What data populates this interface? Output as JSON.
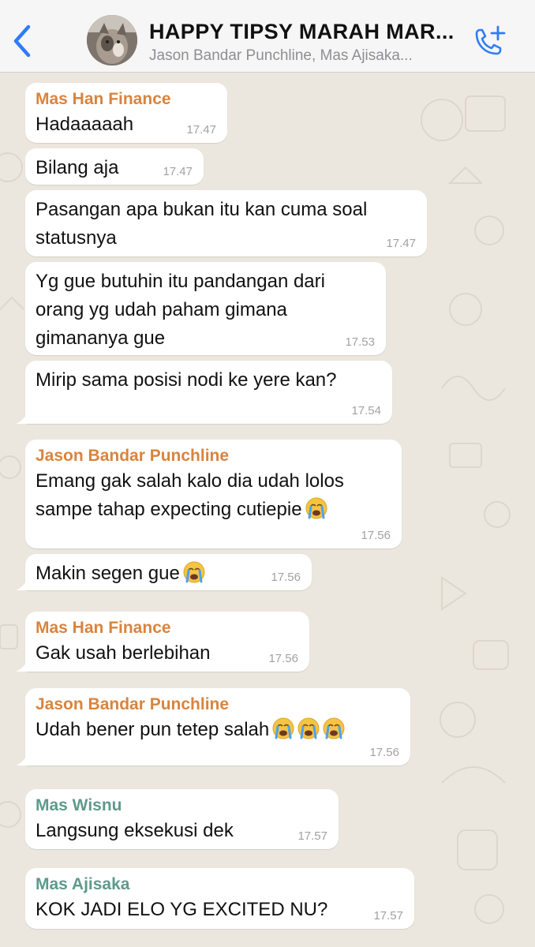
{
  "header": {
    "title": "HAPPY TIPSY MARAH MAR...",
    "subtitle": "Jason Bandar Punchline, Mas Ajisaka...",
    "back_icon": "chevron-left-icon",
    "call_icon": "add-call-icon",
    "accent": "#2f7cf6"
  },
  "colors": {
    "mas_han": "#d8843e",
    "jason": "#d8843e",
    "mas_wisnu": "#5e9a8c",
    "mas_ajisaka": "#5e9a8c"
  },
  "messages": [
    {
      "sender": "Mas Han Finance",
      "lines": [
        "Hadaaaaah"
      ],
      "time": "17.47"
    },
    {
      "sender": "",
      "lines": [
        "Bilang aja"
      ],
      "time": "17.47"
    },
    {
      "sender": "",
      "lines": [
        "Pasangan apa bukan itu kan cuma soal",
        "statusnya"
      ],
      "time": "17.47"
    },
    {
      "sender": "",
      "lines": [
        "Yg gue butuhin itu pandangan dari",
        "orang yg udah paham gimana",
        "gimananya gue"
      ],
      "time": "17.53"
    },
    {
      "sender": "",
      "lines": [
        "Mirip sama posisi nodi ke yere kan?"
      ],
      "time": "17.54"
    },
    {
      "sender": "Jason Bandar Punchline",
      "lines": [
        "Emang gak salah kalo dia udah lolos",
        "sampe tahap expecting cutiepie"
      ],
      "time": "17.56",
      "emoji": "crying-face-emoji"
    },
    {
      "sender": "",
      "lines": [
        "Makin segen gue"
      ],
      "time": "17.56",
      "emoji": "crying-face-emoji"
    },
    {
      "sender": "Mas Han Finance",
      "lines": [
        "Gak usah berlebihan"
      ],
      "time": "17.56"
    },
    {
      "sender": "Jason Bandar Punchline",
      "lines": [
        "Udah bener pun tetep salah"
      ],
      "time": "17.56",
      "emoji": "crying-face-emoji"
    },
    {
      "sender": "Mas Wisnu",
      "lines": [
        "Langsung eksekusi dek"
      ],
      "time": "17.57"
    },
    {
      "sender": "Mas Ajisaka",
      "lines": [
        "KOK JADI ELO YG EXCITED NU?"
      ],
      "time": "17.57"
    }
  ]
}
